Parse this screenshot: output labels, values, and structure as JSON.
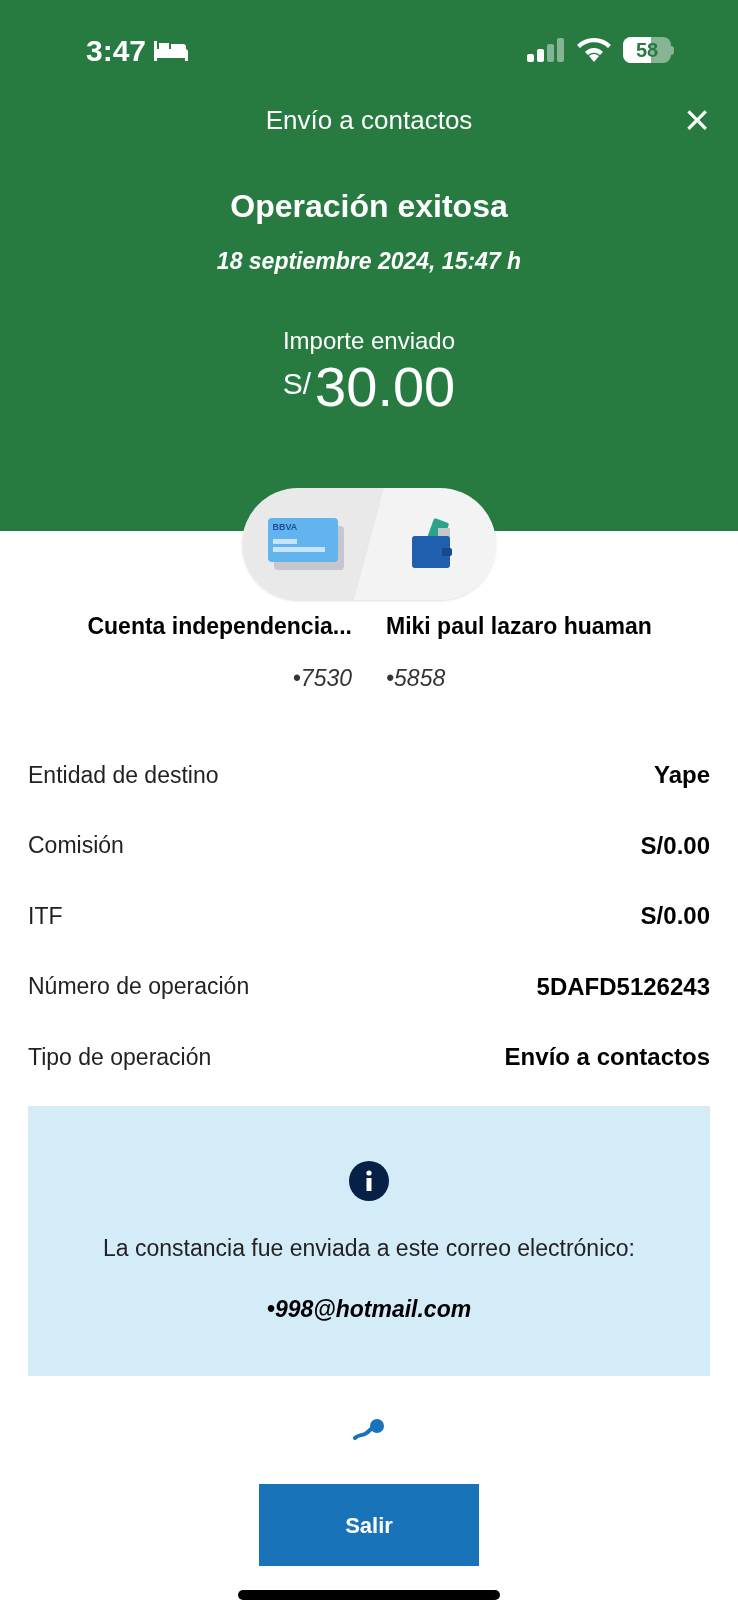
{
  "status_bar": {
    "time": "3:47",
    "battery": "58"
  },
  "header": {
    "title": "Envío a contactos",
    "close": "×",
    "heading": "Operación exitosa",
    "date": "18 septiembre 2024, 15:47 h",
    "amount_label": "Importe enviado",
    "currency": "S/",
    "amount": "30.00"
  },
  "transfer": {
    "card_brand": "BBVA",
    "from": {
      "name": "Cuenta independencia...",
      "number": "•7530"
    },
    "to": {
      "name": "Miki paul lazaro huaman",
      "number": "•5858"
    }
  },
  "details": [
    {
      "label": "Entidad de destino",
      "value": "Yape"
    },
    {
      "label": "Comisión",
      "value": "S/0.00"
    },
    {
      "label": "ITF",
      "value": "S/0.00"
    },
    {
      "label": "Número de operación",
      "value": "5DAFD5126243"
    },
    {
      "label": "Tipo de operación",
      "value": "Envío a contactos"
    }
  ],
  "notice": {
    "text": "La constancia fue enviada a este correo electrónico:",
    "email": "•998@hotmail.com"
  },
  "button": "Salir"
}
